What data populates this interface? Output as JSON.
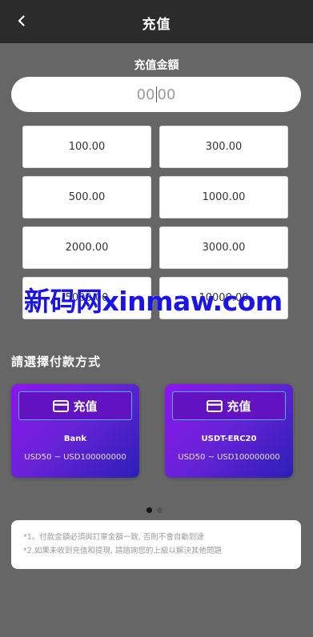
{
  "header": {
    "title": "充值"
  },
  "amount": {
    "label": "充值金額",
    "value_before_caret": "00",
    "value_after_caret": "00"
  },
  "presets": [
    {
      "label": "100.00"
    },
    {
      "label": "300.00"
    },
    {
      "label": "500.00"
    },
    {
      "label": "1000.00"
    },
    {
      "label": "2000.00"
    },
    {
      "label": "3000.00"
    },
    {
      "label": "5000.00"
    },
    {
      "label": "10000.00"
    }
  ],
  "watermark": "新码网xinmaw.com",
  "payment": {
    "section_title": "請選擇付款方式",
    "methods": [
      {
        "button_label": "充值",
        "name": "Bank",
        "range": "USD50 ~ USD100000000"
      },
      {
        "button_label": "充值",
        "name": "USDT-ERC20",
        "range": "USD50 ~ USD100000000"
      }
    ]
  },
  "pagination": {
    "total": 2,
    "active": 1
  },
  "notes": [
    "*1。付款金額必須與訂單金額一致, 否則不會自動到達",
    "*2.如果未收到充值和提現, 請諮詢您的上級以解決其他問題"
  ],
  "colors": {
    "header_bg": "#2b2b2b",
    "page_bg": "#666666",
    "card_start": "#8d14f0",
    "card_end": "#2b1fb8",
    "watermark": "#1a14e6"
  },
  "icons": {
    "back": "chevron-left-icon",
    "card": "credit-card-icon"
  }
}
